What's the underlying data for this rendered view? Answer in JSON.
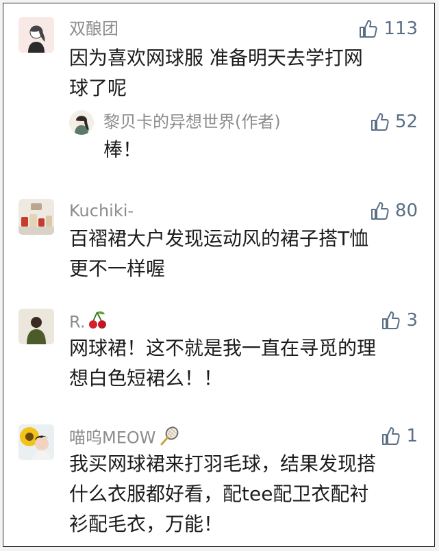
{
  "colors": {
    "name": "#8c8c8c",
    "text": "#1c1c1c",
    "like": "#5a6e86",
    "border": "#2a2a2a"
  },
  "comments": [
    {
      "name": "双酿团",
      "likes": "113",
      "lines": [
        "因为喜欢网球服 准备明天去学打网",
        "球了呢"
      ],
      "avatar_icon": "girl-sketch-avatar",
      "reply": {
        "name": "黎贝卡的异想世界(作者)",
        "likes": "52",
        "lines": [
          "棒！"
        ],
        "avatar_icon": "girl-illustration-avatar"
      }
    },
    {
      "name": "Kuchiki-",
      "likes": "80",
      "lines": [
        "百褶裙大户发现运动风的裙子搭T恤",
        "更不一样喔"
      ],
      "avatar_icon": "jars-avatar"
    },
    {
      "name": "R.",
      "name_emoji": "cherry-icon",
      "likes": "3",
      "lines": [
        "网球裙！这不就是我一直在寻觅的理",
        "想白色短裙么！！"
      ],
      "avatar_icon": "green-coat-avatar"
    },
    {
      "name": "喵呜MEOW",
      "name_emoji": "tennis-racket-icon",
      "likes": "1",
      "lines": [
        "我买网球裙来打羽毛球，结果发现搭",
        "什么衣服都好看，配tee配卫衣配衬",
        "衫配毛衣，万能！"
      ],
      "avatar_icon": "sunflower-avatar"
    }
  ]
}
